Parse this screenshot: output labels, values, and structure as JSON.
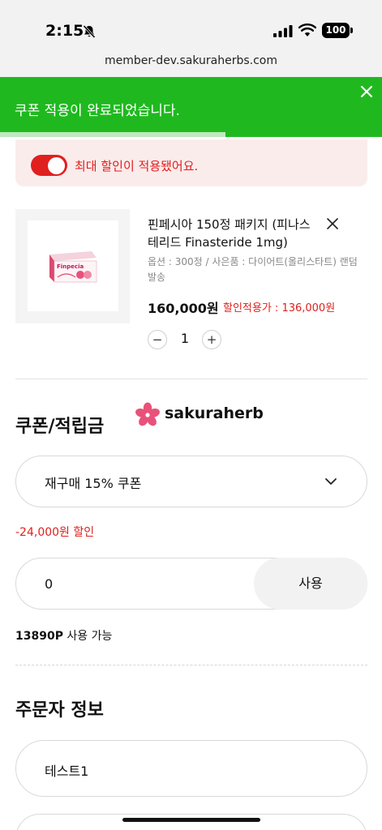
{
  "status_bar": {
    "time": "2:15",
    "battery": "100"
  },
  "browser": {
    "url": "member-dev.sakuraherbs.com"
  },
  "toast": {
    "message": "쿠폰 적용이 완료되었습니다.",
    "progress": 0.59
  },
  "max_discount": {
    "label": "최대 할인이 적용됐어요.",
    "enabled": true
  },
  "product": {
    "box_brand": "Finpecia",
    "name": "핀페시아 150정 패키지 (피나스테리드 Finasteride 1mg)",
    "option": "옵션 : 300정 / 사은품 : 다이어트(올리스타트) 랜덤 발송",
    "price": "160,000원",
    "discount_price": "할인적용가 : 136,000원",
    "quantity": "1",
    "minus": "−",
    "plus": "+"
  },
  "coupon_section": {
    "title": "쿠폰/적립금",
    "logo_text": "sakuraherb",
    "selected_coupon": "재구매 15% 쿠폰",
    "coupon_discount": "-24,000원 할인",
    "point_value": "0",
    "use_button": "사용",
    "points_amount": "13890P",
    "points_suffix": "사용 가능"
  },
  "orderer_section": {
    "title": "주문자 정보",
    "name": "테스트1"
  },
  "colors": {
    "accent_red": "#e0201e",
    "toast_green": "#1fb91f",
    "logo_pink": "#e8527a"
  }
}
